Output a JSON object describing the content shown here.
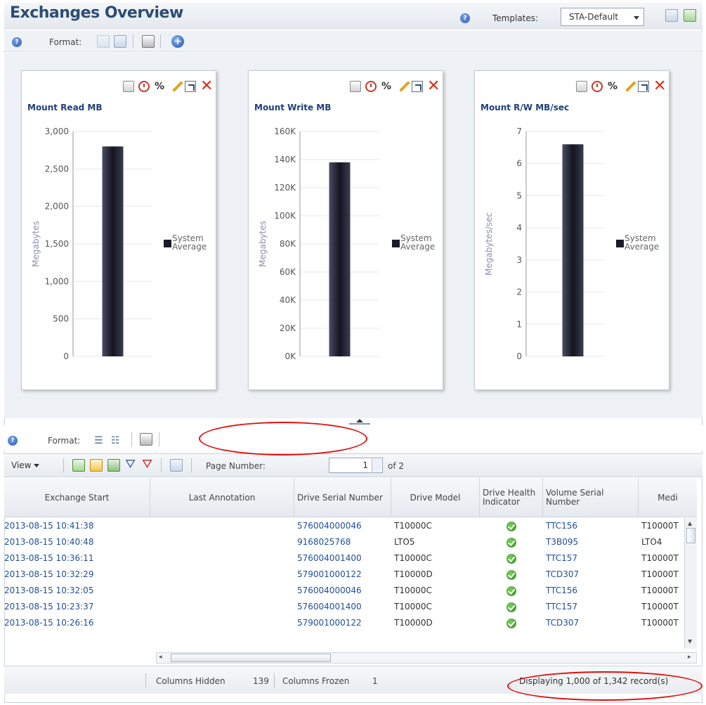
{
  "header": {
    "title": "Exchanges Overview",
    "templates_label": "Templates:",
    "templates_value": "STA-Default"
  },
  "dashboard_toolbar": {
    "format_label": "Format:"
  },
  "panels": [
    {
      "title": "Mount Read MB",
      "ylabel": "Megabytes",
      "ticks": [
        "3,000",
        "2,500",
        "2,000",
        "1,500",
        "1,000",
        "500",
        "0"
      ],
      "legend": [
        "System",
        "Average"
      ]
    },
    {
      "title": "Mount Write MB",
      "ylabel": "Megabytes",
      "ticks": [
        "160K",
        "140K",
        "120K",
        "100K",
        "80K",
        "60K",
        "40K",
        "20K",
        "0K"
      ],
      "legend": [
        "System",
        "Average"
      ]
    },
    {
      "title": "Mount R/W MB/sec",
      "ylabel": "Megabytes/sec",
      "ticks": [
        "7",
        "6",
        "5",
        "4",
        "3",
        "2",
        "1",
        "0"
      ],
      "legend": [
        "System",
        "Average"
      ]
    }
  ],
  "chart_data": [
    {
      "type": "bar",
      "title": "Mount Read MB",
      "ylabel": "Megabytes",
      "categories": [
        ""
      ],
      "series": [
        {
          "name": "System Average",
          "values": [
            2800
          ]
        }
      ],
      "ylim": [
        0,
        3000
      ],
      "legend_position": "right"
    },
    {
      "type": "bar",
      "title": "Mount Write MB",
      "ylabel": "Megabytes",
      "categories": [
        ""
      ],
      "series": [
        {
          "name": "System Average",
          "values": [
            138000
          ]
        }
      ],
      "ylim": [
        0,
        160000
      ],
      "legend_position": "right"
    },
    {
      "type": "bar",
      "title": "Mount R/W MB/sec",
      "ylabel": "Megabytes/sec",
      "categories": [
        ""
      ],
      "series": [
        {
          "name": "System Average",
          "values": [
            6.6
          ]
        }
      ],
      "ylim": [
        0,
        7
      ],
      "legend_position": "right"
    }
  ],
  "table_toolbar": {
    "format_label": "Format:",
    "view_label": "View",
    "page_number_label": "Page Number:",
    "page_number_value": "1",
    "page_of": "of 2"
  },
  "table": {
    "columns": [
      "Exchange Start",
      "Last Annotation",
      "Drive Serial Number",
      "Drive Model",
      "Drive Health Indicator",
      "Volume Serial Number",
      "Medi"
    ],
    "rows": [
      [
        "2013-08-15 10:41:38",
        "",
        "576004000046",
        "T10000C",
        "ok",
        "TTC156",
        "T10000T"
      ],
      [
        "2013-08-15 10:40:48",
        "",
        "9168025768",
        "LTO5",
        "ok",
        "T3B095",
        "LTO4"
      ],
      [
        "2013-08-15 10:36:11",
        "",
        "576004001400",
        "T10000C",
        "ok",
        "TTC157",
        "T10000T"
      ],
      [
        "2013-08-15 10:32:29",
        "",
        "579001000122",
        "T10000D",
        "ok",
        "TCD307",
        "T10000T"
      ],
      [
        "2013-08-15 10:32:05",
        "",
        "576004000046",
        "T10000C",
        "ok",
        "TTC156",
        "T10000T"
      ],
      [
        "2013-08-15 10:23:37",
        "",
        "576004001400",
        "T10000C",
        "ok",
        "TTC157",
        "T10000T"
      ],
      [
        "2013-08-15 10:26:16",
        "",
        "579001000122",
        "T10000D",
        "ok",
        "TCD307",
        "T10000T"
      ]
    ]
  },
  "footer": {
    "columns_hidden_label": "Columns Hidden",
    "columns_hidden_value": "139",
    "columns_frozen_label": "Columns Frozen",
    "columns_frozen_value": "1",
    "records_text": "Displaying 1,000 of 1,342 record(s)"
  },
  "colors": {
    "title": "#2d4c72",
    "link": "#1f4f96",
    "bar": "#1a1b2a",
    "annotation": "#e10e0e"
  }
}
